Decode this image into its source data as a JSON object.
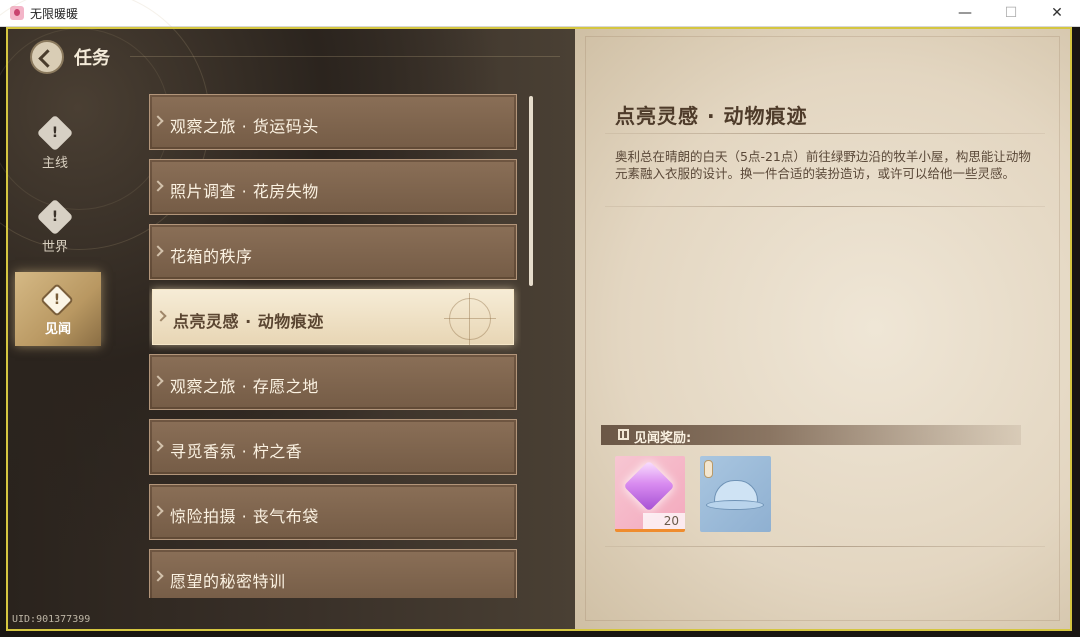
{
  "window": {
    "title": "无限暖暖"
  },
  "header": {
    "title": "任务"
  },
  "categories": [
    {
      "label": "主线"
    },
    {
      "label": "世界"
    },
    {
      "label": "见闻"
    }
  ],
  "quests": [
    {
      "name": "观察之旅 · 货运码头"
    },
    {
      "name": "照片调查 · 花房失物"
    },
    {
      "name": "花箱的秩序"
    },
    {
      "name": "点亮灵感 · 动物痕迹"
    },
    {
      "name": "观察之旅 · 存愿之地"
    },
    {
      "name": "寻觅香氛 · 柠之香"
    },
    {
      "name": "惊险拍摄 · 丧气布袋"
    },
    {
      "name": "愿望的秘密特训"
    }
  ],
  "selected_quest_index": 3,
  "detail": {
    "title": "点亮灵感 · 动物痕迹",
    "description": "奥利总在晴朗的白天（5点-21点）前往绿野边沿的牧羊小屋，构思能让动物元素融入衣服的设计。换一件合适的装扮造访，或许可以给他一些灵感。",
    "rewards_label": "见闻奖励:",
    "rewards": [
      {
        "icon": "gem-icon",
        "count": "20"
      },
      {
        "icon": "bucket-hat-icon"
      }
    ]
  },
  "footer": {
    "uid": "UID:901377399"
  },
  "colors": {
    "frame": "#d5c640",
    "active_item": "#f6ecd6",
    "item": "#8a6f57",
    "parchment": "#e3d6c1"
  }
}
